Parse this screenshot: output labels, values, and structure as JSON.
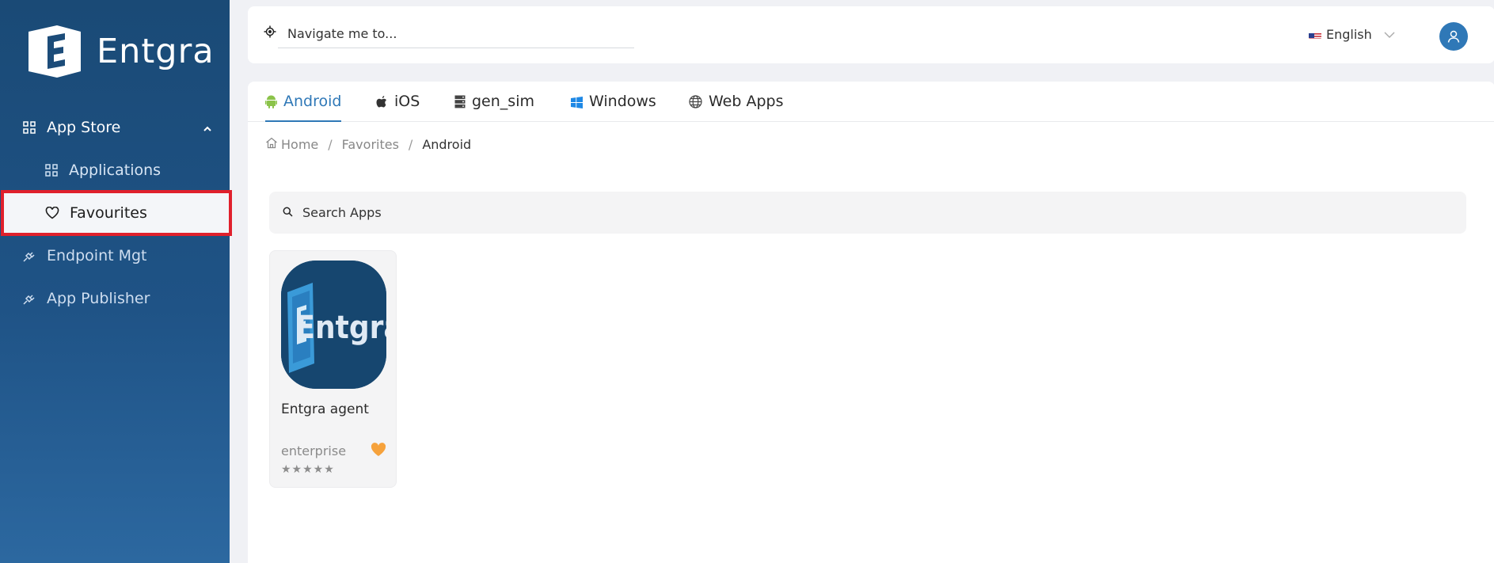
{
  "brand": {
    "name": "Entgra"
  },
  "sidebar": {
    "items": [
      {
        "label": "App Store",
        "icon": "grid-icon"
      },
      {
        "label": "Applications",
        "icon": "grid-icon"
      },
      {
        "label": "Favourites",
        "icon": "heart-icon"
      },
      {
        "label": "Endpoint Mgt",
        "icon": "plug-icon"
      },
      {
        "label": "App Publisher",
        "icon": "plug-icon"
      }
    ]
  },
  "topbar": {
    "nav_placeholder": "Navigate me to...",
    "language": "English"
  },
  "tabs": [
    {
      "label": "Android",
      "icon": "android-icon",
      "active": true
    },
    {
      "label": "iOS",
      "icon": "apple-icon"
    },
    {
      "label": "gen_sim",
      "icon": "server-icon"
    },
    {
      "label": "Windows",
      "icon": "windows-icon"
    },
    {
      "label": "Web Apps",
      "icon": "globe-icon"
    }
  ],
  "breadcrumb": {
    "home": "Home",
    "favorites": "Favorites",
    "current": "Android"
  },
  "search": {
    "placeholder": "Search Apps"
  },
  "apps": [
    {
      "name": "Entgra agent",
      "category": "enterprise",
      "rating": "★★★★★",
      "favorite": true,
      "logo_text": "Entgra"
    }
  ],
  "colors": {
    "sidebar": "#1f5386",
    "accent": "#2f78b7",
    "highlight": "#e0202c",
    "favorite": "#f6a23c"
  }
}
